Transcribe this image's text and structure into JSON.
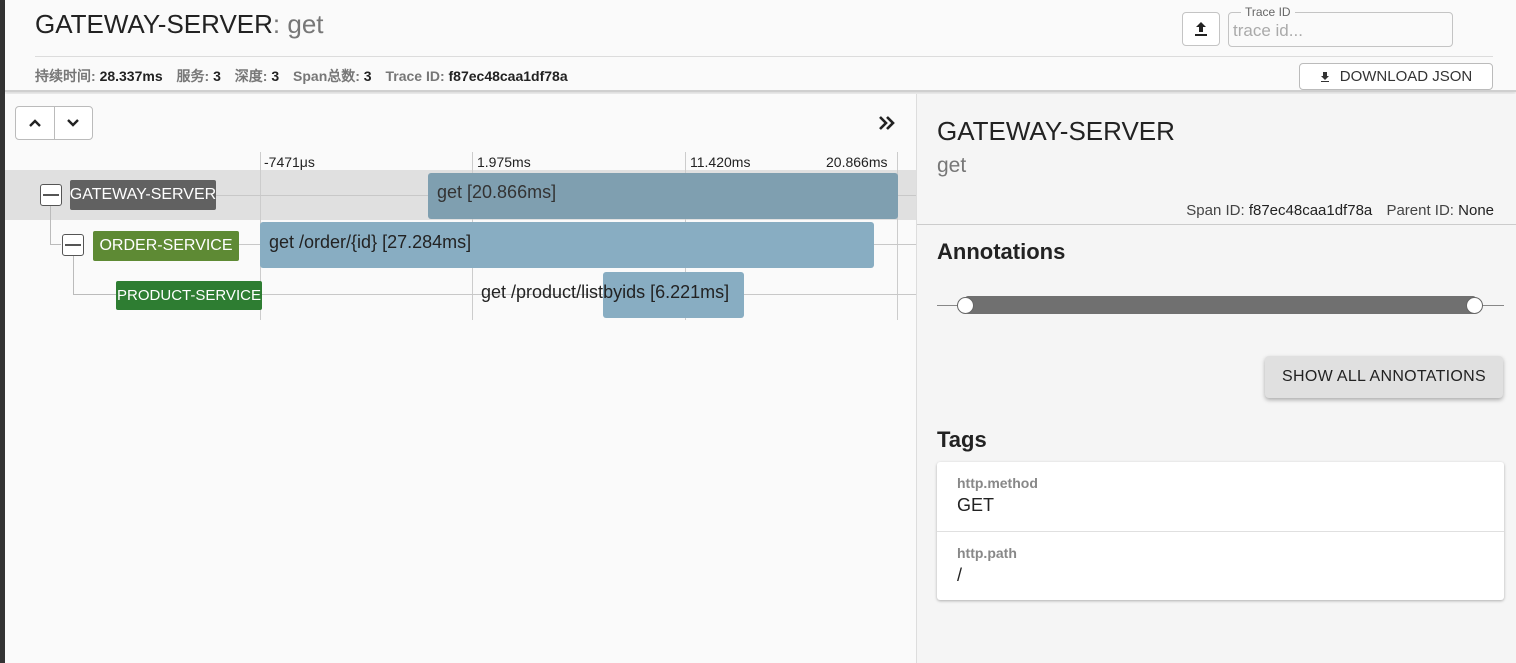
{
  "header": {
    "service": "GATEWAY-SERVER",
    "separator": ":",
    "span_name": "get",
    "stats": [
      {
        "label": "持续时间:",
        "value": "28.337ms"
      },
      {
        "label": "服务:",
        "value": "3"
      },
      {
        "label": "深度:",
        "value": "3"
      },
      {
        "label": "Span总数:",
        "value": "3"
      },
      {
        "label": "Trace ID:",
        "value": "f87ec48caa1df78a"
      }
    ],
    "trace_field_legend": "Trace ID",
    "trace_field_placeholder": "trace id...",
    "download_label": "DOWNLOAD JSON"
  },
  "timeline": {
    "ticks": [
      "-7471μs",
      "1.975ms",
      "11.420ms",
      "20.866ms"
    ],
    "rows": [
      {
        "service": "GATEWAY-SERVER",
        "span": "get [20.866ms]",
        "color": "#616161",
        "bar_color": "#7f9fb0"
      },
      {
        "service": "ORDER-SERVICE",
        "span": "get /order/{id} [27.284ms]",
        "color": "#5e8a34",
        "bar_color": "#88adc2"
      },
      {
        "service": "PRODUCT-SERVICE",
        "span": "get /product/listbyids [6.221ms]",
        "color": "#2e7d32",
        "bar_color": "#88adc2"
      }
    ]
  },
  "detail": {
    "service": "GATEWAY-SERVER",
    "span_name": "get",
    "span_id_label": "Span ID:",
    "span_id": "f87ec48caa1df78a",
    "parent_id_label": "Parent ID:",
    "parent_id": "None",
    "annotations_heading": "Annotations",
    "show_all_label": "SHOW ALL ANNOTATIONS",
    "tags_heading": "Tags",
    "tags": [
      {
        "key": "http.method",
        "value": "GET"
      },
      {
        "key": "http.path",
        "value": "/"
      }
    ]
  }
}
